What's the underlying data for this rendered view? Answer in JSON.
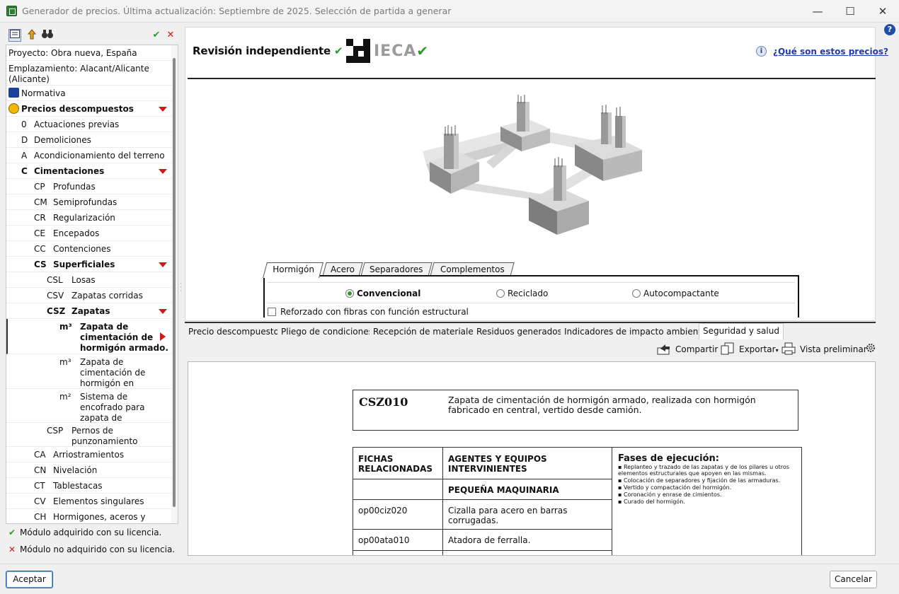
{
  "window": {
    "title": "Generador de precios. Última actualización: Septiembre de 2025. Selección de partida a generar",
    "minimize": "—",
    "maximize": "☐",
    "close": "✕"
  },
  "left_toolbar": {
    "icons": [
      "card-icon",
      "folder-up-icon",
      "binoculars-icon"
    ],
    "check": "✔",
    "cross": "✕"
  },
  "tree": {
    "proyecto": "Proyecto: Obra nueva, España",
    "emplazamiento": "Emplazamiento: Alacant/Alicante (Alicante)",
    "normativa": "Normativa",
    "precios": "Precios descompuestos",
    "chapters": [
      {
        "code": "0",
        "label": "Actuaciones previas"
      },
      {
        "code": "D",
        "label": "Demoliciones"
      },
      {
        "code": "A",
        "label": "Acondicionamiento del terreno"
      },
      {
        "code": "C",
        "label": "Cimentaciones"
      }
    ],
    "cim_children": [
      {
        "code": "CP",
        "label": "Profundas"
      },
      {
        "code": "CM",
        "label": "Semiprofundas"
      },
      {
        "code": "CR",
        "label": "Regularización"
      },
      {
        "code": "CE",
        "label": "Encepados"
      },
      {
        "code": "CC",
        "label": "Contenciones"
      },
      {
        "code": "CS",
        "label": "Superficiales"
      }
    ],
    "cs_children": [
      {
        "code": "CSL",
        "label": "Losas"
      },
      {
        "code": "CSV",
        "label": "Zapatas corridas"
      },
      {
        "code": "CSZ",
        "label": "Zapatas"
      }
    ],
    "items": [
      {
        "unit": "m³",
        "l1": "Zapata de",
        "l2": "cimentación de",
        "l3": "hormigón armado."
      },
      {
        "unit": "m³",
        "l1": "Zapata de",
        "l2": "cimentación de",
        "l3": "hormigón en"
      },
      {
        "unit": "m²",
        "l1": "Sistema de",
        "l2": "encofrado para",
        "l3": "zapata de"
      }
    ],
    "csp": {
      "code": "CSP",
      "l1": "Pernos de",
      "l2": "punzonamiento"
    },
    "more": [
      {
        "code": "CA",
        "label": "Arriostramientos"
      },
      {
        "code": "CN",
        "label": "Nivelación"
      },
      {
        "code": "CT",
        "label": "Tablestacas"
      },
      {
        "code": "CV",
        "label": "Elementos singulares"
      },
      {
        "code": "CH",
        "label": "Hormigones, aceros y"
      }
    ]
  },
  "legend": {
    "acquired": "Módulo adquirido con su licencia.",
    "not_acquired": "Módulo no adquirido con su licencia.",
    "acquired_mark": "✔",
    "not_acquired_mark": "✕"
  },
  "header": {
    "revision": "Revisión independiente",
    "check": "✔",
    "ieca": "IECA",
    "help_link": "¿Qué son estos precios?",
    "info": "i"
  },
  "tabs": [
    "Hormigón",
    "Acero",
    "Separadores",
    "Complementos"
  ],
  "radios": [
    {
      "label": "Convencional",
      "selected": true
    },
    {
      "label": "Reciclado",
      "selected": false
    },
    {
      "label": "Autocompactante",
      "selected": false
    }
  ],
  "fibras": "Reforzado con fibras con función estructural",
  "bottom_tabs": [
    "Precio descompuesto",
    "Pliego de condiciones",
    "Recepción de materiales",
    "Residuos generados",
    "Indicadores de impacto ambiental",
    "Seguridad y salud"
  ],
  "bottom_toolbar": {
    "compartir": "Compartir",
    "exportar": "Exportar",
    "vista": "Vista preliminar"
  },
  "doc": {
    "code": "CSZ010",
    "description": "Zapata de cimentación de hormigón armado, realizada con hormigón fabricado en central, vertido desde camión.",
    "col1": "FICHAS RELACIONADAS",
    "col2": "AGENTES Y EQUIPOS INTERVINIENTES",
    "sub": "PEQUEÑA MAQUINARIA",
    "rows": [
      {
        "code": "op00ciz020",
        "desc": "Cizalla para acero en barras corrugadas."
      },
      {
        "code": "op00ata010",
        "desc": "Atadora de ferralla."
      }
    ],
    "fases_title": "Fases de ejecución:",
    "fases": [
      "Replanteo y trazado de las zapatas y de los pilares u otros elementos estructurales que apoyen en las mismas.",
      "Colocación de separadores y fijación de las armaduras.",
      "Vertido y compactación del hormigón.",
      "Coronación y enrase de cimientos.",
      "Curado del hormigón."
    ]
  },
  "buttons": {
    "aceptar": "Aceptar",
    "cancelar": "Cancelar",
    "help": "?"
  },
  "colors": {
    "accent_red": "#d01818",
    "check_green": "#2e9a2e",
    "link_blue": "#1a3fb0"
  }
}
